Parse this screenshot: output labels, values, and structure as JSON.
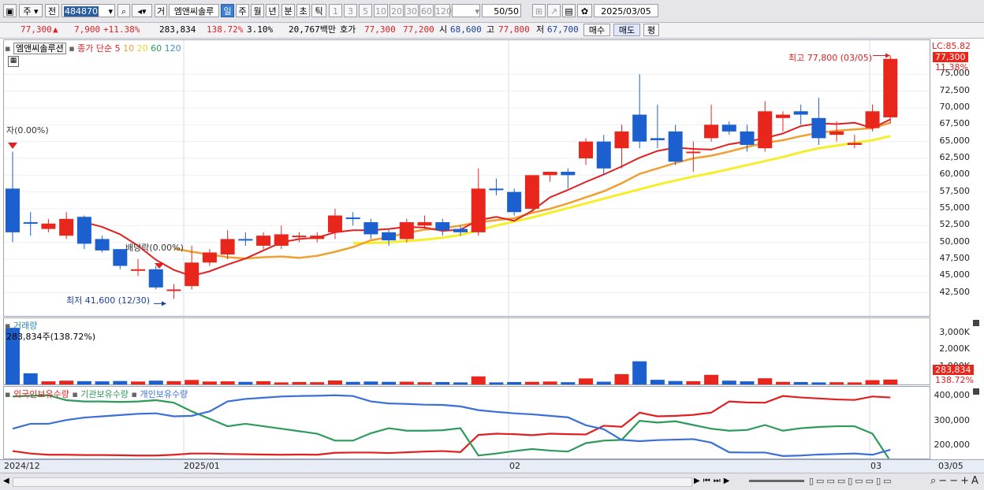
{
  "toolbar": {
    "stock_type": "주",
    "prev_label": "전",
    "stock_code": "484870",
    "trade_label": "거",
    "stock_name": "엠앤씨솔루",
    "periods": [
      "일",
      "주",
      "월",
      "년",
      "분",
      "초",
      "틱"
    ],
    "selected_period": "일",
    "intervals": [
      "1",
      "3",
      "5",
      "10",
      "20",
      "30",
      "60",
      "120"
    ],
    "count_display": "50",
    "count_total": "/50",
    "date": "2025/03/05"
  },
  "infobar": {
    "price": "77,300",
    "change_symbol": "▲",
    "change": "7,900",
    "change_pct": "+11.38%",
    "volume": "283,834",
    "volume_ratio": "138.72%",
    "turnover_pct": "3.10%",
    "amount": "20,767백만",
    "quote_label": "호가",
    "ask": "77,300",
    "bid": "77,200",
    "open_label": "시",
    "open": "68,600",
    "high_label": "고",
    "high": "77,800",
    "low_label": "저",
    "low": "67,700",
    "buy_label": "매수",
    "sell_label": "매도",
    "avg_label": "평"
  },
  "price_pane": {
    "stock_label": "엠앤씨솔루션",
    "ma_title": "종가 단순 5",
    "ma_periods": [
      "10",
      "20",
      "60",
      "120"
    ],
    "ma_colors": {
      "5": "#e02020",
      "10": "#f0a030",
      "20": "#f5ee30",
      "60": "#2e9a5a",
      "120": "#3b8fd0"
    },
    "lc_label": "LC:85.82",
    "last_price_tag": "77,300",
    "last_pct_tag": "11.38%",
    "y_ticks": [
      "75,000",
      "72,500",
      "70,000",
      "67,500",
      "65,000",
      "62,500",
      "60,000",
      "57,500",
      "55,000",
      "52,500",
      "50,000",
      "47,500",
      "45,000",
      "42,500"
    ],
    "annotation_high": "최고 77,800 (03/05)",
    "annotation_low": "최저 41,600 (12/30)",
    "annotation_ja": "자(0.00%)",
    "annotation_div": "배당락(0.00%)"
  },
  "volume_pane": {
    "title": "거래량",
    "value_label": "283,834주(138.72%)",
    "y_ticks": [
      "3,000K",
      "2,000K",
      "1,000K"
    ],
    "last_tag": "283,834",
    "last_pct_tag": "138.72%"
  },
  "holding_pane": {
    "legend": [
      "외국인보유수량",
      "기관보유수량",
      "개인보유수량"
    ],
    "legend_colors": [
      "#e02020",
      "#2e9a5a",
      "#3b6fd8"
    ],
    "y_ticks": [
      "400,000",
      "300,000",
      "200,000"
    ]
  },
  "time_axis": [
    "2024/12",
    "2025/01",
    "02",
    "03",
    "03/05"
  ],
  "colors": {
    "up": "#e8261c",
    "down": "#1c5fce",
    "toolbar_sel": "#3b7fd1"
  },
  "chart_data": [
    {
      "type": "candlestick",
      "title": "엠앤씨솔루션",
      "y_unit": "KRW",
      "ylim": [
        40000,
        77500
      ],
      "ohlc": [
        {
          "o": 58000,
          "h": 63500,
          "l": 50000,
          "c": 51500,
          "dir": "down"
        },
        {
          "o": 53000,
          "h": 54500,
          "l": 51000,
          "c": 52800,
          "dir": "down"
        },
        {
          "o": 52000,
          "h": 53500,
          "l": 51500,
          "c": 52800,
          "dir": "up"
        },
        {
          "o": 51000,
          "h": 54500,
          "l": 50500,
          "c": 53500,
          "dir": "up"
        },
        {
          "o": 53800,
          "h": 54000,
          "l": 49000,
          "c": 49800,
          "dir": "down"
        },
        {
          "o": 50500,
          "h": 51000,
          "l": 48500,
          "c": 48800,
          "dir": "down"
        },
        {
          "o": 49000,
          "h": 49000,
          "l": 46000,
          "c": 46500,
          "dir": "down"
        },
        {
          "o": 46000,
          "h": 47500,
          "l": 45000,
          "c": 46000,
          "dir": "up"
        },
        {
          "o": 46000,
          "h": 46500,
          "l": 43000,
          "c": 43300,
          "dir": "down"
        },
        {
          "o": 42800,
          "h": 43800,
          "l": 41600,
          "c": 43000,
          "dir": "up"
        },
        {
          "o": 43500,
          "h": 49500,
          "l": 43000,
          "c": 47000,
          "dir": "up"
        },
        {
          "o": 47000,
          "h": 49000,
          "l": 46500,
          "c": 48500,
          "dir": "up"
        },
        {
          "o": 48200,
          "h": 51800,
          "l": 47500,
          "c": 50500,
          "dir": "up"
        },
        {
          "o": 50500,
          "h": 51500,
          "l": 49500,
          "c": 50300,
          "dir": "down"
        },
        {
          "o": 49500,
          "h": 51500,
          "l": 49000,
          "c": 51000,
          "dir": "up"
        },
        {
          "o": 49500,
          "h": 52500,
          "l": 49000,
          "c": 51200,
          "dir": "up"
        },
        {
          "o": 51000,
          "h": 51500,
          "l": 50000,
          "c": 51000,
          "dir": "up"
        },
        {
          "o": 50500,
          "h": 51500,
          "l": 50000,
          "c": 51000,
          "dir": "up"
        },
        {
          "o": 51500,
          "h": 55000,
          "l": 50500,
          "c": 54000,
          "dir": "up"
        },
        {
          "o": 53700,
          "h": 54500,
          "l": 52500,
          "c": 53500,
          "dir": "down"
        },
        {
          "o": 53000,
          "h": 53500,
          "l": 50500,
          "c": 51200,
          "dir": "down"
        },
        {
          "o": 51500,
          "h": 52000,
          "l": 49500,
          "c": 50300,
          "dir": "down"
        },
        {
          "o": 50500,
          "h": 53500,
          "l": 50000,
          "c": 53000,
          "dir": "up"
        },
        {
          "o": 52500,
          "h": 54000,
          "l": 52000,
          "c": 53000,
          "dir": "up"
        },
        {
          "o": 53000,
          "h": 53500,
          "l": 51000,
          "c": 51800,
          "dir": "down"
        },
        {
          "o": 52000,
          "h": 52500,
          "l": 51000,
          "c": 51500,
          "dir": "down"
        },
        {
          "o": 51500,
          "h": 61000,
          "l": 51000,
          "c": 58000,
          "dir": "up"
        },
        {
          "o": 58000,
          "h": 59500,
          "l": 57000,
          "c": 58000,
          "dir": "down"
        },
        {
          "o": 57500,
          "h": 58000,
          "l": 54000,
          "c": 54500,
          "dir": "down"
        },
        {
          "o": 55000,
          "h": 60000,
          "l": 54500,
          "c": 60000,
          "dir": "up"
        },
        {
          "o": 60000,
          "h": 60500,
          "l": 59000,
          "c": 60500,
          "dir": "up"
        },
        {
          "o": 60500,
          "h": 61000,
          "l": 58000,
          "c": 60000,
          "dir": "down"
        },
        {
          "o": 62500,
          "h": 65500,
          "l": 61500,
          "c": 65000,
          "dir": "up"
        },
        {
          "o": 65000,
          "h": 66000,
          "l": 60000,
          "c": 61000,
          "dir": "down"
        },
        {
          "o": 64000,
          "h": 67500,
          "l": 61000,
          "c": 66500,
          "dir": "up"
        },
        {
          "o": 69000,
          "h": 75000,
          "l": 64000,
          "c": 65000,
          "dir": "down"
        },
        {
          "o": 65500,
          "h": 70500,
          "l": 64000,
          "c": 65200,
          "dir": "down"
        },
        {
          "o": 66500,
          "h": 67500,
          "l": 61500,
          "c": 62000,
          "dir": "down"
        },
        {
          "o": 63500,
          "h": 65000,
          "l": 60500,
          "c": 63500,
          "dir": "up"
        },
        {
          "o": 65500,
          "h": 70500,
          "l": 65000,
          "c": 67500,
          "dir": "up"
        },
        {
          "o": 67500,
          "h": 68000,
          "l": 66000,
          "c": 66500,
          "dir": "down"
        },
        {
          "o": 66500,
          "h": 67500,
          "l": 63500,
          "c": 64500,
          "dir": "down"
        },
        {
          "o": 64000,
          "h": 71000,
          "l": 63500,
          "c": 69500,
          "dir": "up"
        },
        {
          "o": 69000,
          "h": 69500,
          "l": 66500,
          "c": 68500,
          "dir": "up"
        },
        {
          "o": 69500,
          "h": 70500,
          "l": 67500,
          "c": 69000,
          "dir": "down"
        },
        {
          "o": 68500,
          "h": 71500,
          "l": 64500,
          "c": 65500,
          "dir": "down"
        },
        {
          "o": 66000,
          "h": 68000,
          "l": 65000,
          "c": 66500,
          "dir": "up"
        },
        {
          "o": 64500,
          "h": 66000,
          "l": 64000,
          "c": 64800,
          "dir": "up"
        },
        {
          "o": 67000,
          "h": 70500,
          "l": 66500,
          "c": 69500,
          "dir": "up"
        },
        {
          "o": 68600,
          "h": 77800,
          "l": 67700,
          "c": 77300,
          "dir": "up"
        }
      ],
      "ma5": [
        null,
        null,
        null,
        null,
        53000,
        52300,
        51200,
        49500,
        47400,
        45900,
        45000,
        45700,
        46700,
        47600,
        48800,
        50000,
        50500,
        50700,
        51500,
        51800,
        51800,
        52000,
        52300,
        52200,
        51700,
        51900,
        53300,
        53800,
        53200,
        54700,
        56700,
        57800,
        59000,
        60100,
        61300,
        62600,
        63600,
        64100,
        63900,
        63800,
        64600,
        65000,
        65500,
        66200,
        67300,
        67700,
        67600,
        67800,
        67000,
        68300
      ],
      "ma10": [
        null,
        null,
        null,
        null,
        null,
        null,
        null,
        null,
        null,
        49100,
        48600,
        48200,
        47800,
        47600,
        47800,
        47900,
        47700,
        48000,
        48600,
        49300,
        50300,
        50800,
        51400,
        51900,
        52100,
        52500,
        53000,
        53300,
        53600,
        54400,
        55000,
        55800,
        56700,
        57600,
        58800,
        60200,
        61000,
        61800,
        62500,
        62900,
        63500,
        64200,
        64800,
        65200,
        65800,
        66300,
        66600,
        66800,
        67000,
        67800
      ],
      "ma20": [
        null,
        null,
        null,
        null,
        null,
        null,
        null,
        null,
        null,
        null,
        null,
        null,
        null,
        null,
        null,
        null,
        null,
        null,
        null,
        49900,
        49900,
        50000,
        50200,
        50400,
        50700,
        51100,
        51800,
        52500,
        53100,
        53700,
        54400,
        55100,
        55800,
        56500,
        57200,
        57900,
        58600,
        59200,
        59800,
        60300,
        60900,
        61500,
        62100,
        62700,
        63400,
        64000,
        64400,
        64800,
        65200,
        65800
      ]
    },
    {
      "type": "bar",
      "title": "거래량",
      "y_unit": "shares",
      "ylim": [
        0,
        3400000
      ],
      "values": [
        3300000,
        650000,
        180000,
        220000,
        190000,
        180000,
        200000,
        170000,
        220000,
        190000,
        260000,
        170000,
        180000,
        150000,
        190000,
        120000,
        140000,
        130000,
        230000,
        150000,
        170000,
        150000,
        160000,
        130000,
        140000,
        120000,
        470000,
        120000,
        140000,
        150000,
        170000,
        130000,
        350000,
        160000,
        600000,
        1350000,
        270000,
        200000,
        190000,
        560000,
        220000,
        180000,
        360000,
        150000,
        140000,
        120000,
        130000,
        120000,
        250000,
        283834
      ],
      "dir": [
        "down",
        "down",
        "up",
        "up",
        "down",
        "down",
        "down",
        "up",
        "down",
        "up",
        "up",
        "up",
        "up",
        "down",
        "up",
        "up",
        "up",
        "up",
        "up",
        "down",
        "down",
        "down",
        "up",
        "up",
        "down",
        "down",
        "up",
        "down",
        "down",
        "up",
        "up",
        "down",
        "up",
        "down",
        "up",
        "down",
        "down",
        "down",
        "up",
        "up",
        "down",
        "down",
        "up",
        "up",
        "down",
        "down",
        "up",
        "up",
        "up",
        "up"
      ]
    },
    {
      "type": "line",
      "title": "보유수량",
      "ylim": [
        150000,
        420000
      ],
      "series": [
        {
          "name": "외국인보유수량",
          "color": "#e02020",
          "values": [
            180000,
            170000,
            165000,
            165000,
            164000,
            164000,
            163000,
            162000,
            162000,
            165000,
            170000,
            170000,
            168000,
            167000,
            166000,
            165000,
            166000,
            165000,
            173000,
            174000,
            174000,
            172000,
            175000,
            178000,
            180000,
            176000,
            245000,
            250000,
            248000,
            244000,
            250000,
            248000,
            247000,
            282000,
            278000,
            335000,
            320000,
            322000,
            326000,
            335000,
            380000,
            376000,
            375000,
            402000,
            396000,
            392000,
            388000,
            386000,
            400000,
            396000
          ]
        },
        {
          "name": "기관보유수량",
          "color": "#2e9a5a",
          "values": [
            400000,
            403000,
            405000,
            385000,
            380000,
            380000,
            378000,
            380000,
            385000,
            375000,
            340000,
            310000,
            280000,
            290000,
            280000,
            270000,
            260000,
            250000,
            222000,
            222000,
            252000,
            272000,
            262000,
            262000,
            264000,
            272000,
            162000,
            170000,
            180000,
            188000,
            182000,
            178000,
            212000,
            222000,
            225000,
            302000,
            295000,
            300000,
            285000,
            270000,
            262000,
            265000,
            285000,
            262000,
            272000,
            277000,
            280000,
            280000,
            250000,
            140000
          ]
        },
        {
          "name": "개인보유수량",
          "color": "#3b6fd8",
          "values": [
            270000,
            290000,
            290000,
            305000,
            315000,
            320000,
            325000,
            330000,
            332000,
            320000,
            322000,
            340000,
            380000,
            390000,
            395000,
            400000,
            402000,
            403000,
            405000,
            402000,
            380000,
            372000,
            370000,
            367000,
            366000,
            360000,
            345000,
            338000,
            332000,
            328000,
            322000,
            316000,
            284000,
            268000,
            225000,
            220000,
            224000,
            226000,
            228000,
            214000,
            175000,
            174000,
            174000,
            160000,
            162000,
            166000,
            168000,
            170000,
            165000,
            185000
          ]
        }
      ]
    }
  ]
}
